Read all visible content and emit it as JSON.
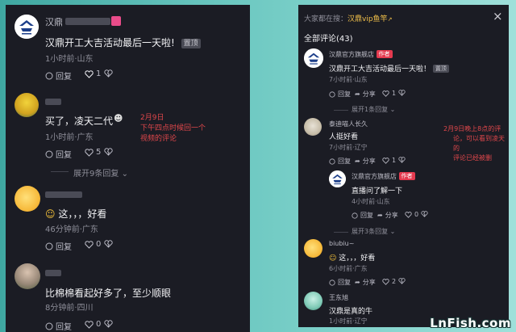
{
  "left": {
    "comments": [
      {
        "username": "汉鼎",
        "text": "汉鼎开工大吉活动最后一天啦!",
        "badge": "置顶",
        "meta": "1小时前·山东",
        "reply": "回复",
        "likes": "1"
      },
      {
        "text": "买了，凌天二代",
        "meta": "1小时前·广东",
        "reply": "回复",
        "likes": "5",
        "expand": "展开9条回复"
      },
      {
        "text": "这，，，好看",
        "meta": "46分钟前·广东",
        "reply": "回复",
        "likes": "0"
      },
      {
        "text": "比棉棉看起好多了，至少顺眼",
        "meta": "8分钟前·四川",
        "reply": "回复",
        "likes": "0"
      }
    ],
    "annotation": [
      "2月9日",
      "下午四点时候回一个",
      "视频的评论"
    ]
  },
  "right": {
    "search_prefix": "大家都在搜：",
    "search_term": "汉鼎vip鱼竿",
    "close": "×",
    "title": "全部评论(43)",
    "comments": [
      {
        "username": "汉鼎官方旗舰店",
        "author_tag": "作者",
        "text": "汉鼎开工大吉活动最后一天啦！",
        "badge": "置顶",
        "meta": "7小时前·山东",
        "reply": "回复",
        "share": "分享",
        "likes": "1",
        "expand": "展开1条回复"
      },
      {
        "username": "泰迪喵人长久",
        "text": "人挺好看",
        "meta": "7小时前·辽宁",
        "reply": "回复",
        "share": "分享",
        "likes": "1"
      },
      {
        "username": "汉鼎官方旗舰店",
        "author_tag": "作者",
        "text": "直播问了解一下",
        "meta": "4小时前·山东",
        "reply": "回复",
        "share": "分享",
        "likes": "0",
        "expand": "展开3条回复"
      },
      {
        "username": "biubiu~",
        "text": "这，，，好看",
        "meta": "6小时前·广东",
        "reply": "回复",
        "share": "分享",
        "likes": "2"
      },
      {
        "username": "王东旭",
        "text": "汉鼎是真的牛",
        "meta": "1小时前·辽宁"
      }
    ],
    "annotation": [
      "2月9日晚上8点的评",
      "论，可以看到凌天的",
      "评论已经被删"
    ]
  },
  "watermark": "LnFish.com",
  "colors": {
    "panel": "#1b1c24",
    "author_tag": "#e53a4f",
    "annotation": "#e0474b",
    "background": "#6cc8c1"
  }
}
